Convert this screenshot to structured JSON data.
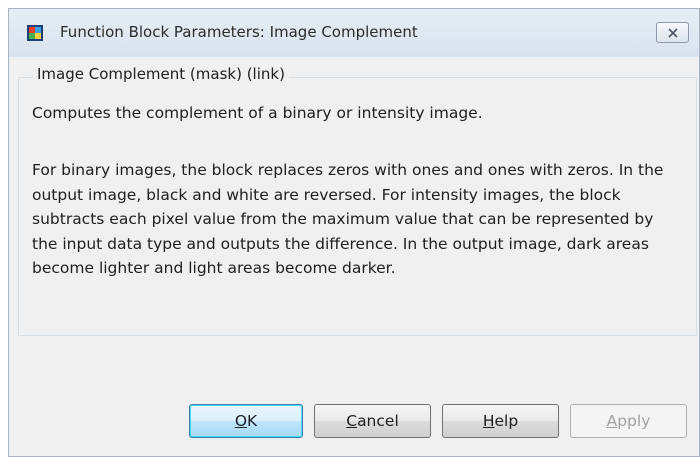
{
  "window": {
    "title": "Function Block Parameters: Image Complement",
    "icon": "simulink-block-icon",
    "close_icon": "close-icon"
  },
  "group": {
    "title": "Image Complement (mask) (link)",
    "description_1": "Computes the complement of a binary or intensity image.",
    "description_2": "For binary images, the block replaces zeros with ones and ones with zeros.  In the output image, black and white are reversed. For intensity images, the block subtracts each pixel value from the maximum value that can be represented by the input data type and outputs the difference.  In the output image, dark areas become lighter and light areas become darker."
  },
  "buttons": {
    "ok": {
      "mnemonic": "O",
      "rest": "K"
    },
    "cancel": {
      "mnemonic": "C",
      "rest": "ancel"
    },
    "help": {
      "mnemonic": "H",
      "rest": "elp"
    },
    "apply": {
      "mnemonic": "A",
      "rest": "pply",
      "enabled": false
    }
  }
}
